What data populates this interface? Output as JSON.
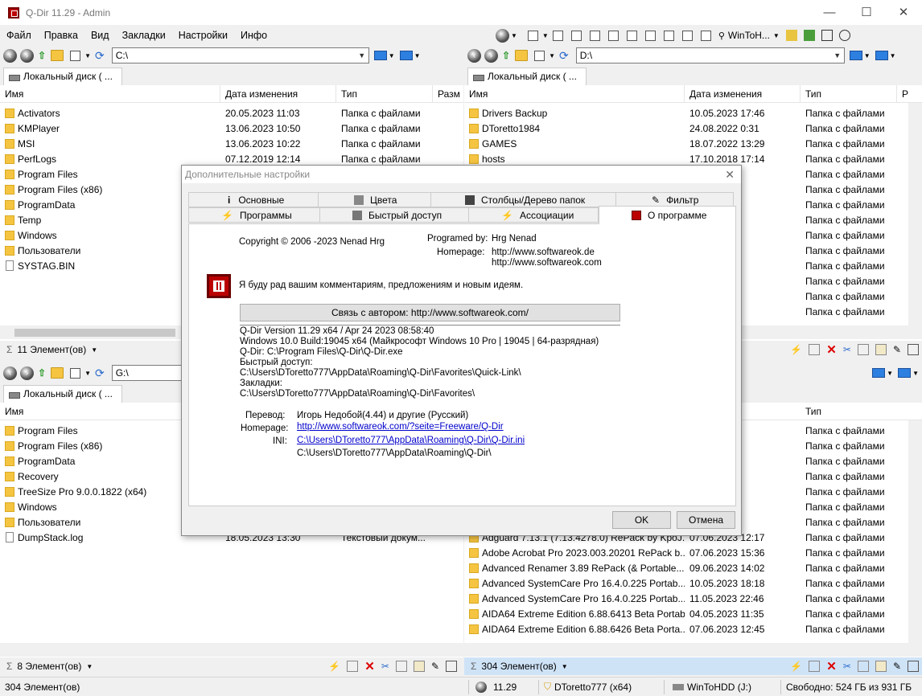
{
  "window": {
    "title": "Q-Dir 11.29 - Admin"
  },
  "menu": [
    "Файл",
    "Правка",
    "Вид",
    "Закладки",
    "Настройки",
    "Инфо"
  ],
  "toolbar": {
    "wintohdd_label": "WinToH..."
  },
  "pane_tl": {
    "path": "C:\\",
    "tab": "Локальный диск ( ...",
    "columns": [
      "Имя",
      "Дата изменения",
      "Тип",
      "Разм"
    ],
    "rows": [
      {
        "name": "Activators",
        "date": "20.05.2023 11:03",
        "type": "Папка с файлами"
      },
      {
        "name": "KMPlayer",
        "date": "13.06.2023 10:50",
        "type": "Папка с файлами"
      },
      {
        "name": "MSI",
        "date": "13.06.2023 10:22",
        "type": "Папка с файлами"
      },
      {
        "name": "PerfLogs",
        "date": "07.12.2019 12:14",
        "type": "Папка с файлами"
      },
      {
        "name": "Program Files",
        "date": "",
        "type": ""
      },
      {
        "name": "Program Files (x86)",
        "date": "",
        "type": ""
      },
      {
        "name": "ProgramData",
        "date": "",
        "type": ""
      },
      {
        "name": "Temp",
        "date": "",
        "type": ""
      },
      {
        "name": "Windows",
        "date": "",
        "type": ""
      },
      {
        "name": "Пользователи",
        "date": "",
        "type": ""
      },
      {
        "name": "SYSTAG.BIN",
        "date": "",
        "type": "",
        "file": true
      }
    ],
    "status": "11 Элемент(ов)"
  },
  "pane_tr": {
    "path": "D:\\",
    "tab": "Локальный диск ( ...",
    "columns": [
      "Имя",
      "Дата изменения",
      "Тип",
      "Р"
    ],
    "rows": [
      {
        "name": "Drivers Backup",
        "date": "10.05.2023 17:46",
        "type": "Папка с файлами"
      },
      {
        "name": "DToretto1984",
        "date": "24.08.2022 0:31",
        "type": "Папка с файлами"
      },
      {
        "name": "GAMES",
        "date": "18.07.2022 13:29",
        "type": "Папка с файлами"
      },
      {
        "name": "hosts",
        "date": "17.10.2018 17:14",
        "type": "Папка с файлами"
      },
      {
        "name": "",
        "date": "3:14",
        "type": "Папка с файлами"
      },
      {
        "name": "",
        "date": "0:17",
        "type": "Папка с файлами"
      },
      {
        "name": "",
        "date": "9:29",
        "type": "Папка с файлами"
      },
      {
        "name": "",
        "date": "2:38",
        "type": "Папка с файлами"
      },
      {
        "name": "",
        "date": "1:29",
        "type": "Папка с файлами"
      },
      {
        "name": "",
        "date": "0:40",
        "type": "Папка с файлами"
      },
      {
        "name": "",
        "date": "0:46",
        "type": "Папка с файлами"
      },
      {
        "name": "",
        "date": "4:08",
        "type": "Папка с файлами"
      },
      {
        "name": "",
        "date": "0:18",
        "type": "Папка с файлами"
      },
      {
        "name": "",
        "date": "0:48",
        "type": "Папка с файлами"
      }
    ]
  },
  "pane_bl": {
    "path": "G:\\",
    "tab": "Локальный диск ( ...",
    "columns": [
      "Имя"
    ],
    "rows": [
      {
        "name": "Program Files",
        "date": "",
        "type": ""
      },
      {
        "name": "Program Files (x86)",
        "date": "",
        "type": ""
      },
      {
        "name": "ProgramData",
        "date": "",
        "type": ""
      },
      {
        "name": "Recovery",
        "date": "",
        "type": ""
      },
      {
        "name": "TreeSize Pro 9.0.0.1822 (x64)",
        "date": "",
        "type": ""
      },
      {
        "name": "Windows",
        "date": "",
        "type": ""
      },
      {
        "name": "Пользователи",
        "date": "",
        "type": ""
      },
      {
        "name": "DumpStack.log",
        "date": "18.05.2023 13:30",
        "type": "Текстовый докум...",
        "file": true
      }
    ],
    "status": "8 Элемент(ов)"
  },
  "pane_br": {
    "columns": [
      "Тип"
    ],
    "rows": [
      {
        "name": "",
        "date": "0:39",
        "type": "Папка с файлами"
      },
      {
        "name": "",
        "date": "2:15",
        "type": "Папка с файлами"
      },
      {
        "name": "",
        "date": "1:11",
        "type": "Папка с файлами"
      },
      {
        "name": "",
        "date": "9:27",
        "type": "Папка с файлами"
      },
      {
        "name": "",
        "date": "0:37",
        "type": "Папка с файлами"
      },
      {
        "name": "",
        "date": "7:37",
        "type": "Папка с файлами"
      },
      {
        "name": "",
        "date": "1:26",
        "type": "Папка с файлами"
      },
      {
        "name": "Adguard 7.13.1 (7.13.4278.0) RePack by KpoJ...",
        "date": "07.06.2023 12:17",
        "type": "Папка с файлами"
      },
      {
        "name": "Adobe Acrobat Pro 2023.003.20201 RePack b...",
        "date": "07.06.2023 15:36",
        "type": "Папка с файлами"
      },
      {
        "name": "Advanced Renamer 3.89 RePack (& Portable...",
        "date": "09.06.2023 14:02",
        "type": "Папка с файлами"
      },
      {
        "name": "Advanced SystemCare Pro 16.4.0.225 Portab...",
        "date": "10.05.2023 18:18",
        "type": "Папка с файлами"
      },
      {
        "name": "Advanced SystemCare Pro 16.4.0.225 Portab...",
        "date": "11.05.2023 22:46",
        "type": "Папка с файлами"
      },
      {
        "name": "AIDA64 Extreme Edition 6.88.6413 Beta Portab...",
        "date": "04.05.2023 11:35",
        "type": "Папка с файлами"
      },
      {
        "name": "AIDA64 Extreme Edition 6.88.6426 Beta Porta...",
        "date": "07.06.2023 12:45",
        "type": "Папка с файлами"
      }
    ],
    "status": "304 Элемент(ов)"
  },
  "dialog": {
    "title": "Дополнительные настройки",
    "tabs_row1": [
      "Основные",
      "Цвета",
      "Столбцы/Дерево папок",
      "Фильтр"
    ],
    "tabs_row2": [
      "Программы",
      "Быстрый доступ",
      "Ассоциации",
      "О программе"
    ],
    "copyright": "Copyright © 2006 -2023 Nenad Hrg",
    "programed_by_label": "Programed by:",
    "programed_by": "Hrg Nenad",
    "homepage_label": "Homepage:",
    "homepage1": "http://www.softwareok.de",
    "homepage2": "http://www.softwareok.com",
    "message": "Я буду рад вашим комментариям, предложениям и новым идеям.",
    "contact_button": "Связь с автором: http://www.softwareok.com/",
    "sysinfo": [
      "Q-Dir Version 11.29  x64  /  Apr 24 2023 08:58:40",
      "Windows 10.0 Build:19045 x64 (Майкрософт Windows 10 Pro | 19045 | 64-разрядная)",
      "Q-Dir: C:\\Program Files\\Q-Dir\\Q-Dir.exe",
      "Быстрый доступ:",
      "C:\\Users\\DToretto777\\AppData\\Roaming\\Q-Dir\\Favorites\\Quick-Link\\",
      "Закладки:",
      "C:\\Users\\DToretto777\\AppData\\Roaming\\Q-Dir\\Favorites\\"
    ],
    "translation_label": "Перевод:",
    "translation": "Игорь Недобой(4.44) и другие  (Русский)",
    "homepage2_label": "Homepage:",
    "translation_homepage": "http://www.softwareok.com/?seite=Freeware/Q-Dir",
    "ini_label": "INI:",
    "ini_link": "C:\\Users\\DToretto777\\AppData\\Roaming\\Q-Dir\\Q-Dir.ini",
    "ini_dir": "C:\\Users\\DToretto777\\AppData\\Roaming\\Q-Dir\\",
    "ok": "OK",
    "cancel": "Отмена"
  },
  "statusbar": {
    "items_total": "304 Элемент(ов)",
    "version": "11.29",
    "user": "DToretto777 (x64)",
    "drive": "WinToHDD (J:)",
    "free": "Свободно: 524 ГБ из 931 ГБ"
  }
}
